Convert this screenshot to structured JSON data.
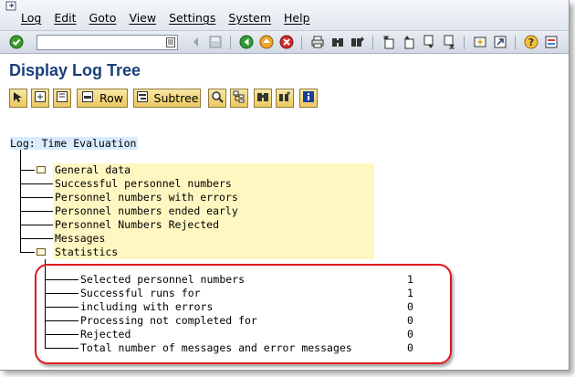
{
  "menu": [
    "Log",
    "Edit",
    "Goto",
    "View",
    "Settings",
    "System",
    "Help"
  ],
  "icons": {
    "system": "system-menu-icon",
    "confirm": "checkmark-icon",
    "command_field": "dropdown-icon",
    "back": "back-icon",
    "exit": "exit-icon",
    "cancel": "cancel-icon",
    "print": "print-icon",
    "find": "find-icon",
    "find_next": "find-next-icon",
    "page_first": "first-page-icon",
    "page_prev": "previous-page-icon",
    "page_next": "next-page-icon",
    "page_last": "last-page-icon",
    "new_session": "new-session-icon",
    "shortcut": "shortcut-icon",
    "help": "help-icon",
    "layout": "layout-icon"
  },
  "colors": {
    "title": "#1a3f7a",
    "node_bg": "#fff7c2",
    "root_bg": "#d9ecff",
    "highlight": "#e0161e"
  },
  "title": "Display Log Tree",
  "app_toolbar": {
    "row_label": "Row",
    "subtree_label": "Subtree"
  },
  "tree": {
    "root": "Log: Time Evaluation",
    "nodes": [
      "General data",
      "Successful personnel numbers",
      "Personnel numbers with errors",
      "Personnel numbers ended early",
      "Personnel Numbers Rejected",
      "Messages",
      "Statistics"
    ],
    "statistics": [
      {
        "label": "Selected personnel numbers",
        "value": "1"
      },
      {
        "label": "Successful runs for",
        "value": "1"
      },
      {
        "label": "including with errors",
        "value": "0"
      },
      {
        "label": "Processing not completed for",
        "value": "0"
      },
      {
        "label": "Rejected",
        "value": "0"
      },
      {
        "label": "Total number of messages and error messages",
        "value": "0"
      }
    ]
  }
}
